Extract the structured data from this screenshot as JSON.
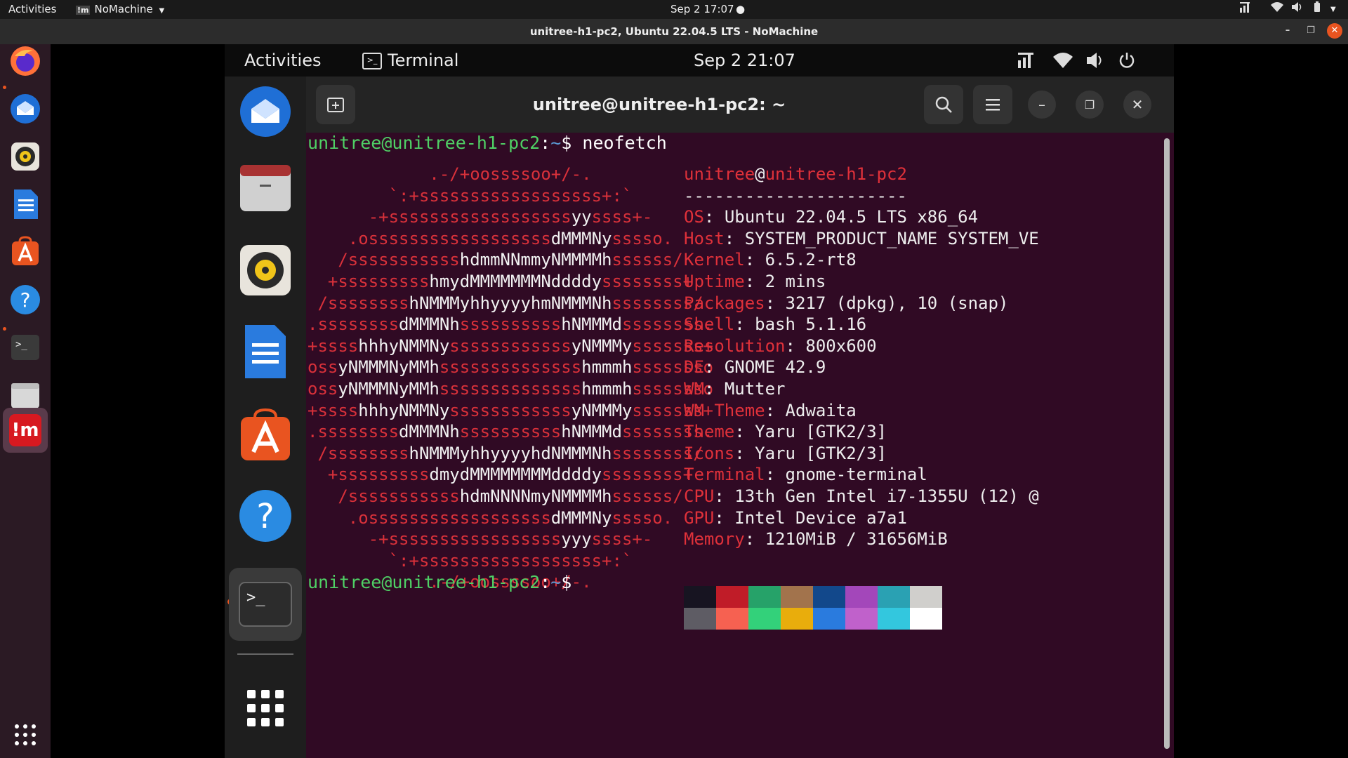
{
  "host_topbar": {
    "activities": "Activities",
    "app_name": "NoMachine",
    "app_icon_text": "!m",
    "clock": "Sep 2  17:07"
  },
  "nomachine_window": {
    "title": "unitree-h1-pc2, Ubuntu 22.04.5 LTS - NoMachine"
  },
  "host_dock": {
    "items": [
      "firefox",
      "thunderbird",
      "rhythmbox",
      "libreoffice-writer",
      "app-center",
      "help",
      "terminal",
      "files",
      "nomachine",
      "show-apps"
    ],
    "nomachine_icon_text": "!m"
  },
  "remote_topbar": {
    "activities": "Activities",
    "app_name": "Terminal",
    "clock": "Sep 2  21:07"
  },
  "terminal": {
    "title": "unitree@unitree-h1-pc2: ~",
    "prompt_user_host": "unitree@unitree-h1-pc2",
    "prompt_path": "~",
    "prompt_symbol": "$",
    "command": "neofetch",
    "logo_lines": [
      "            .-/+oossssoo+/-.",
      "        `:+ssssssssssssssssss+:`",
      "      -+ssssssssssssssssssyyssss+-",
      "    .ossssssssssssssssssdMMMNysssso.",
      "   /ssssssssssshdmmNNmmyNMMMMhssssss/",
      "  +ssssssssshmydMMMMMMMNddddyssssssss+",
      " /sssssssshNMMMyhhyyyyhmNMMMNhssssssss/",
      ".ssssssssdMMMNhsssssssssshNMMMdssssssss.",
      "+sssshhhyNMMNyssssssssssssyNMMMysssssss+",
      "ossyNMMMNyMMhsssssssssssssshmmmhssssssso",
      "ossyNMMMNyMMhsssssssssssssshmmmhssssssso",
      "+sssshhhyNMMNyssssssssssssyNMMMysssssss+",
      ".ssssssssdMMMNhsssssssssshNMMMdssssssss.",
      " /sssssssshNMMMyhhyyyyhdNMMMNhssssssss/",
      "  +sssssssssdmydMMMMMMMMddddyssssssss+",
      "   /ssssssssssshdmNNNNmyNMMMMhssssss/",
      "    .ossssssssssssssssssdMMMNysssso.",
      "      -+sssssssssssssssssyyyssss+-",
      "        `:+ssssssssssssssssss+:`",
      "            .-/+oossssoo+/-."
    ],
    "info_user": "unitree",
    "info_at": "@",
    "info_host": "unitree-h1-pc2",
    "info_separator": "----------------------",
    "info": [
      {
        "key": "OS",
        "value": "Ubuntu 22.04.5 LTS x86_64"
      },
      {
        "key": "Host",
        "value": "SYSTEM_PRODUCT_NAME SYSTEM_VE"
      },
      {
        "key": "Kernel",
        "value": "6.5.2-rt8"
      },
      {
        "key": "Uptime",
        "value": "2 mins"
      },
      {
        "key": "Packages",
        "value": "3217 (dpkg), 10 (snap)"
      },
      {
        "key": "Shell",
        "value": "bash 5.1.16"
      },
      {
        "key": "Resolution",
        "value": "800x600"
      },
      {
        "key": "DE",
        "value": "GNOME 42.9"
      },
      {
        "key": "WM",
        "value": "Mutter"
      },
      {
        "key": "WM Theme",
        "value": "Adwaita"
      },
      {
        "key": "Theme",
        "value": "Yaru [GTK2/3]"
      },
      {
        "key": "Icons",
        "value": "Yaru [GTK2/3]"
      },
      {
        "key": "Terminal",
        "value": "gnome-terminal"
      },
      {
        "key": "CPU",
        "value": "13th Gen Intel i7-1355U (12) @"
      },
      {
        "key": "GPU",
        "value": "Intel Device a7a1"
      },
      {
        "key": "Memory",
        "value": "1210MiB / 31656MiB"
      }
    ],
    "palette": [
      "#171421",
      "#c01c28",
      "#26a269",
      "#a2734c",
      "#12488b",
      "#a347ba",
      "#2aa1b3",
      "#d0cfcc",
      "#5e5c64",
      "#f66151",
      "#33d17a",
      "#e9ad0c",
      "#2a7bde",
      "#c061cb",
      "#33c7de",
      "#ffffff"
    ]
  },
  "colors": {
    "terminal_bg": "#300a24",
    "prompt_green": "#4fd065",
    "path_blue": "#5b9bd5",
    "ubuntu_red": "#e0313a",
    "accent_orange": "#e95420"
  }
}
